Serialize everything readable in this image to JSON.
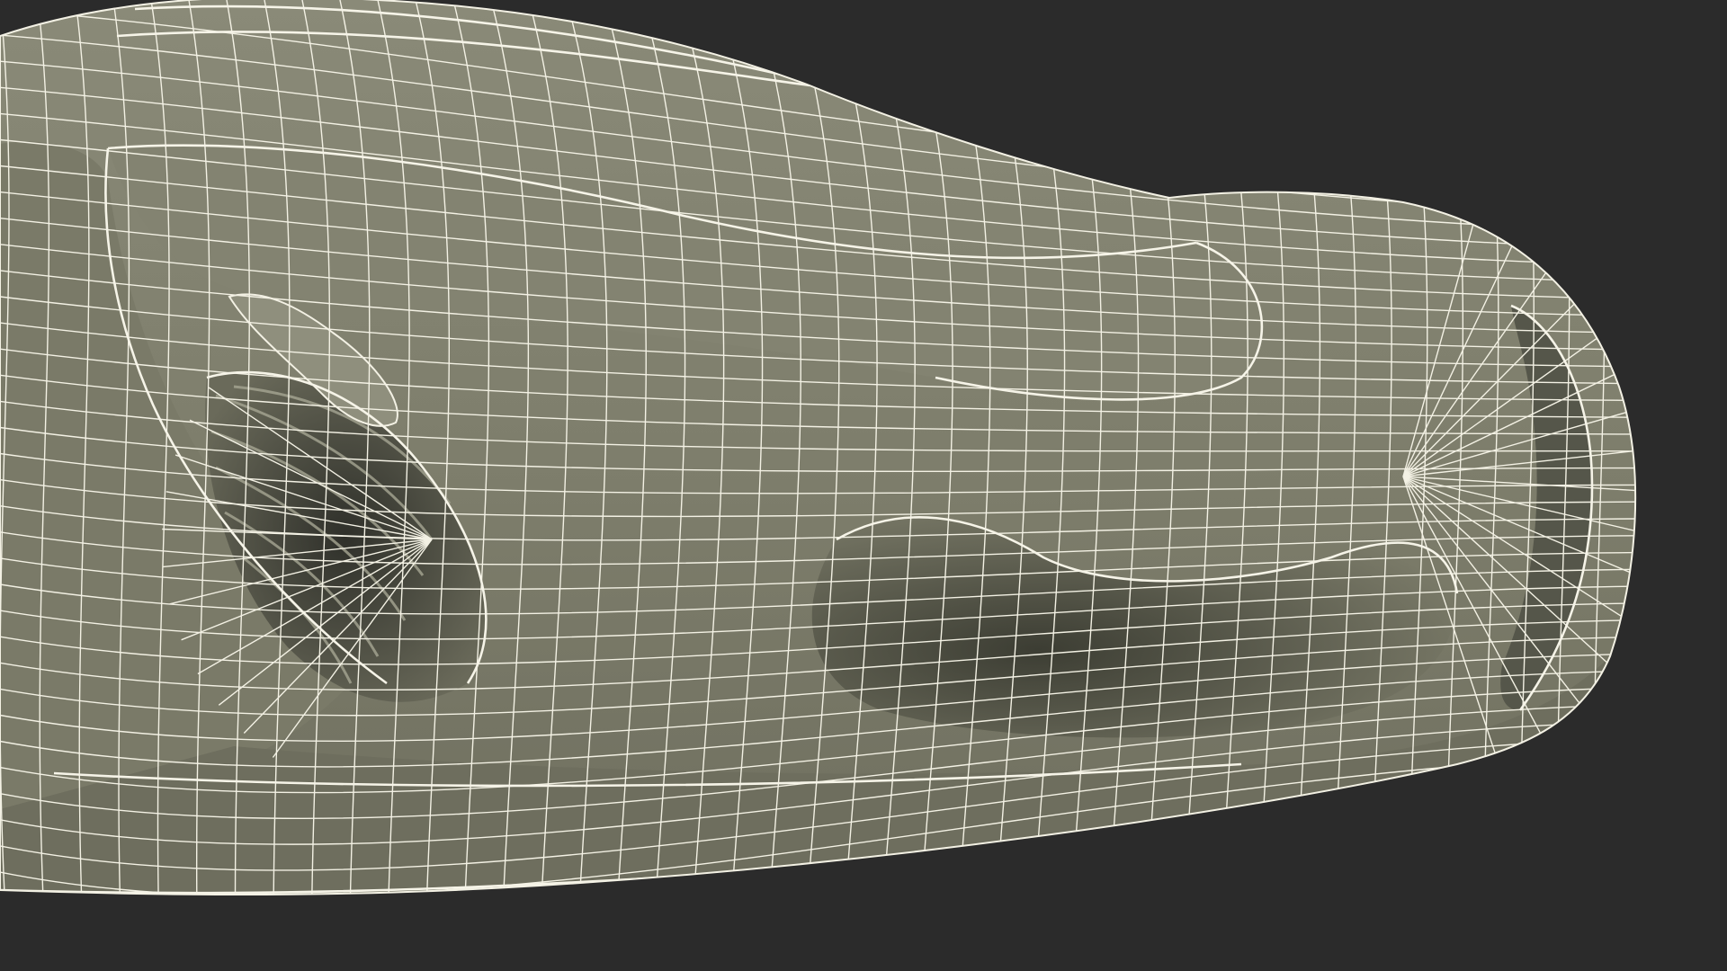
{
  "scene": {
    "subject": "car-front-wireframe",
    "colors": {
      "background": "#2b2b2b",
      "surface": "#7d7d6b",
      "surface_light": "#8a8a78",
      "surface_dark": "#5a5a4c",
      "cavity": "#3a3b30",
      "wire": "#f3f1e4"
    }
  }
}
